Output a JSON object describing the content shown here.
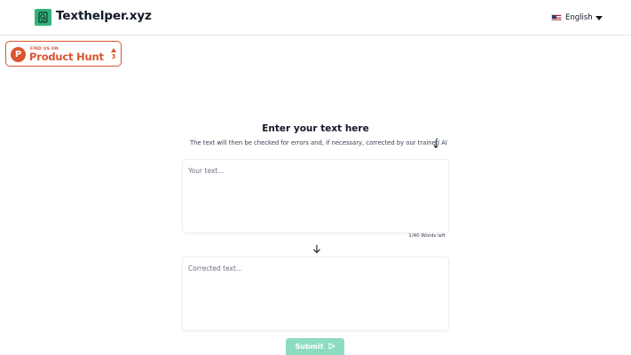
{
  "header": {
    "brand": "Texthelper.xyz",
    "language": "English"
  },
  "product_hunt": {
    "tagline": "FIND US ON",
    "name": "Product Hunt",
    "logo_letter": "P",
    "upvotes": "3"
  },
  "main": {
    "title": "Enter your text here",
    "subtitle": "The text will then be checked for errors and, if necessary, corrected by our trained AI",
    "input_placeholder": "Your text...",
    "words_left": "1/40 Words left",
    "output_placeholder": "Corrected text...",
    "submit_label": "Submit"
  },
  "colors": {
    "brand_green": "#34b27b",
    "product_hunt_orange": "#da552f",
    "submit_bg": "#8edcc0"
  }
}
